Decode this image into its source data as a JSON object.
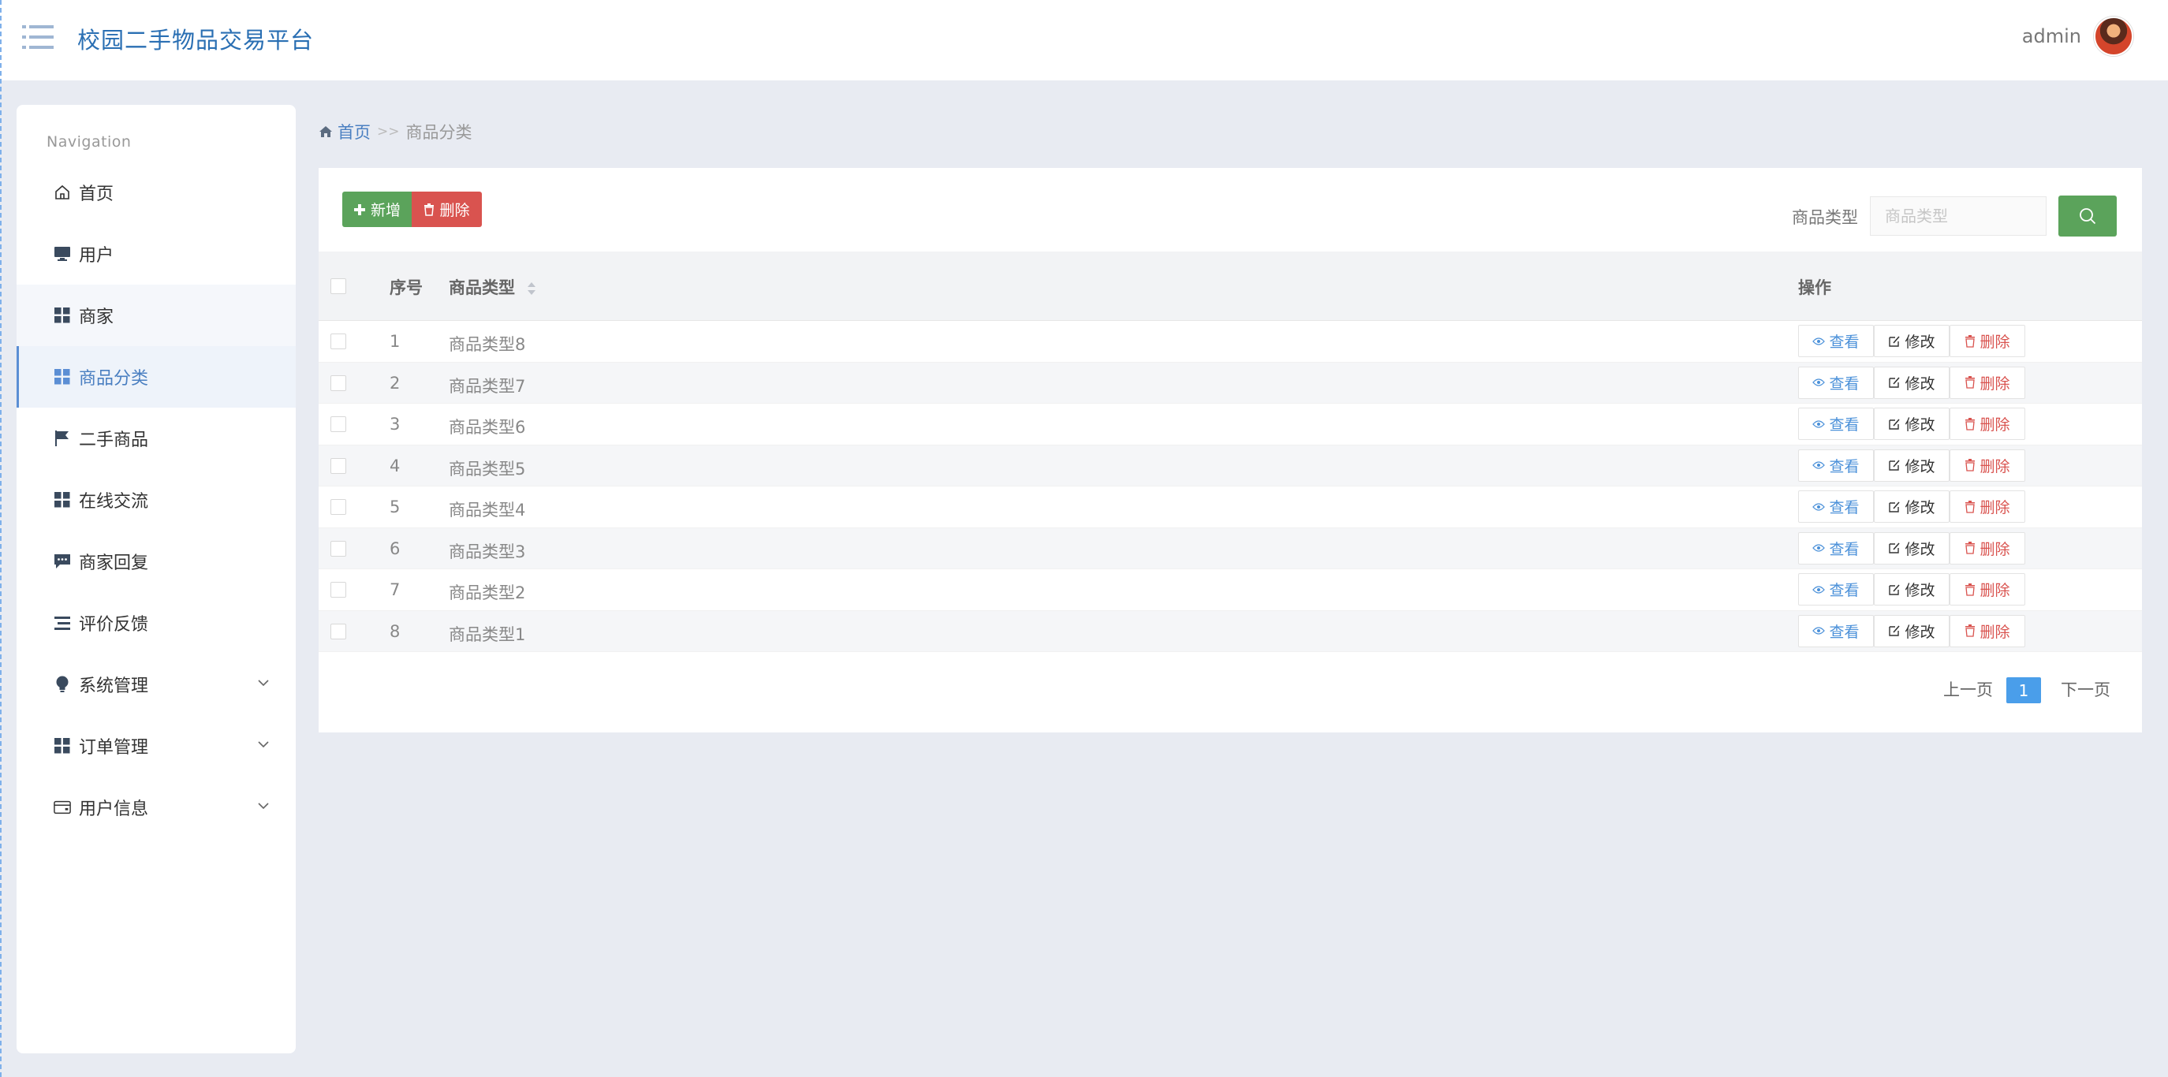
{
  "app": {
    "title": "校园二手物品交易平台",
    "user": "admin"
  },
  "sidebar": {
    "caption": "Navigation",
    "items": [
      {
        "label": "首页",
        "icon": "home-icon"
      },
      {
        "label": "用户",
        "icon": "monitor-icon"
      },
      {
        "label": "商家",
        "icon": "grid-icon"
      },
      {
        "label": "商品分类",
        "icon": "grid-icon",
        "active": true
      },
      {
        "label": "二手商品",
        "icon": "flag-icon"
      },
      {
        "label": "在线交流",
        "icon": "grid-icon"
      },
      {
        "label": "商家回复",
        "icon": "comment-icon"
      },
      {
        "label": "评价反馈",
        "icon": "list-icon"
      },
      {
        "label": "系统管理",
        "icon": "bulb-icon",
        "expandable": true
      },
      {
        "label": "订单管理",
        "icon": "grid-icon",
        "expandable": true
      },
      {
        "label": "用户信息",
        "icon": "wallet-icon",
        "expandable": true
      }
    ]
  },
  "breadcrumb": {
    "home": "首页",
    "separator": ">>",
    "current": "商品分类"
  },
  "toolbar": {
    "add_label": "新增",
    "delete_label": "删除",
    "search_label": "商品类型",
    "search_placeholder": "商品类型"
  },
  "table": {
    "headers": {
      "index": "序号",
      "type": "商品类型",
      "actions": "操作"
    },
    "rows": [
      {
        "index": "1",
        "type": "商品类型8"
      },
      {
        "index": "2",
        "type": "商品类型7"
      },
      {
        "index": "3",
        "type": "商品类型6"
      },
      {
        "index": "4",
        "type": "商品类型5"
      },
      {
        "index": "5",
        "type": "商品类型4"
      },
      {
        "index": "6",
        "type": "商品类型3"
      },
      {
        "index": "7",
        "type": "商品类型2"
      },
      {
        "index": "8",
        "type": "商品类型1"
      }
    ],
    "row_actions": {
      "view": "查看",
      "edit": "修改",
      "delete": "删除"
    }
  },
  "pagination": {
    "prev": "上一页",
    "current": "1",
    "next": "下一页"
  },
  "colors": {
    "accent": "#4a7fc1",
    "success": "#5ba35b",
    "danger": "#d9534f",
    "background": "#e8ebf2"
  }
}
